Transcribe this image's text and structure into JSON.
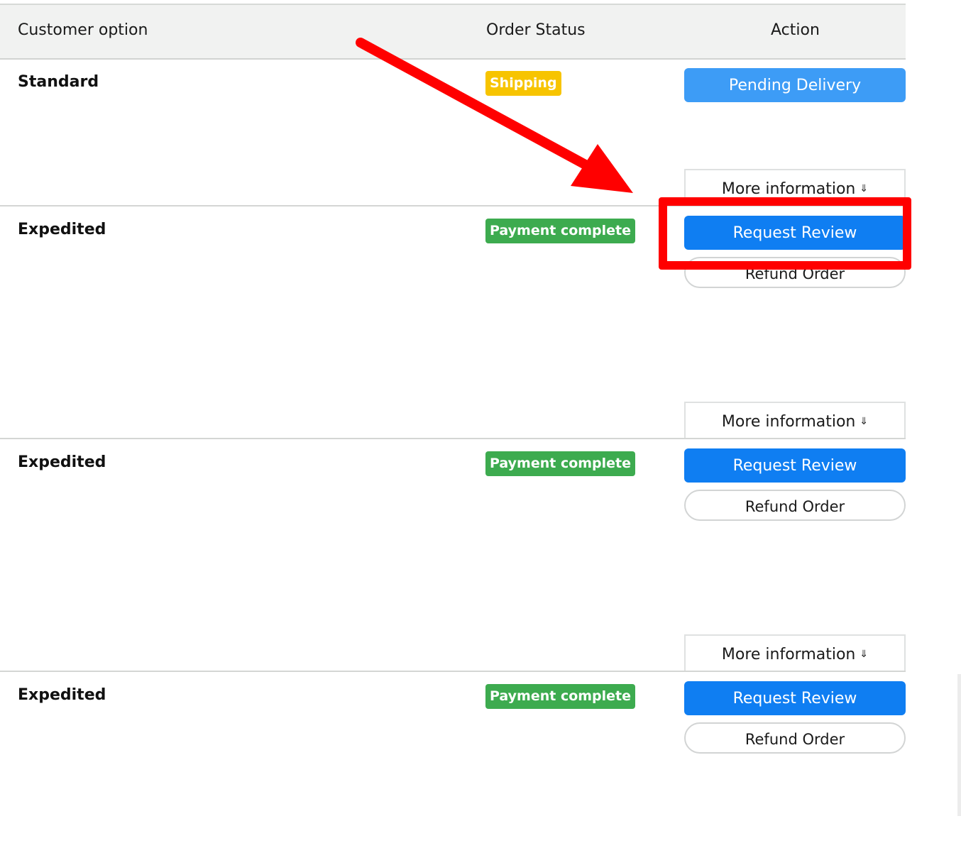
{
  "header": {
    "customer_option": "Customer option",
    "order_status": "Order Status",
    "action": "Action"
  },
  "rows": [
    {
      "option": "Standard",
      "status": "Shipping",
      "primary_action": "Pending Delivery",
      "more_info": "More information"
    },
    {
      "option": "Expedited",
      "status": "Payment complete",
      "primary_action": "Request Review",
      "secondary_action": "Refund Order",
      "more_info": "More information"
    },
    {
      "option": "Expedited",
      "status": "Payment complete",
      "primary_action": "Request Review",
      "secondary_action": "Refund Order",
      "more_info": "More information"
    },
    {
      "option": "Expedited",
      "status": "Payment complete",
      "primary_action": "Request Review",
      "secondary_action": "Refund Order"
    }
  ],
  "colors": {
    "shipping_badge": "#f7c400",
    "payment_badge": "#3dab4f",
    "primary_button": "#0f7ef2",
    "pending_button": "#3d9cf6",
    "annotation": "#ff0000"
  },
  "icons": {
    "more_info": "double-chevron-down-icon",
    "annotation_arrow": "arrow-icon"
  }
}
